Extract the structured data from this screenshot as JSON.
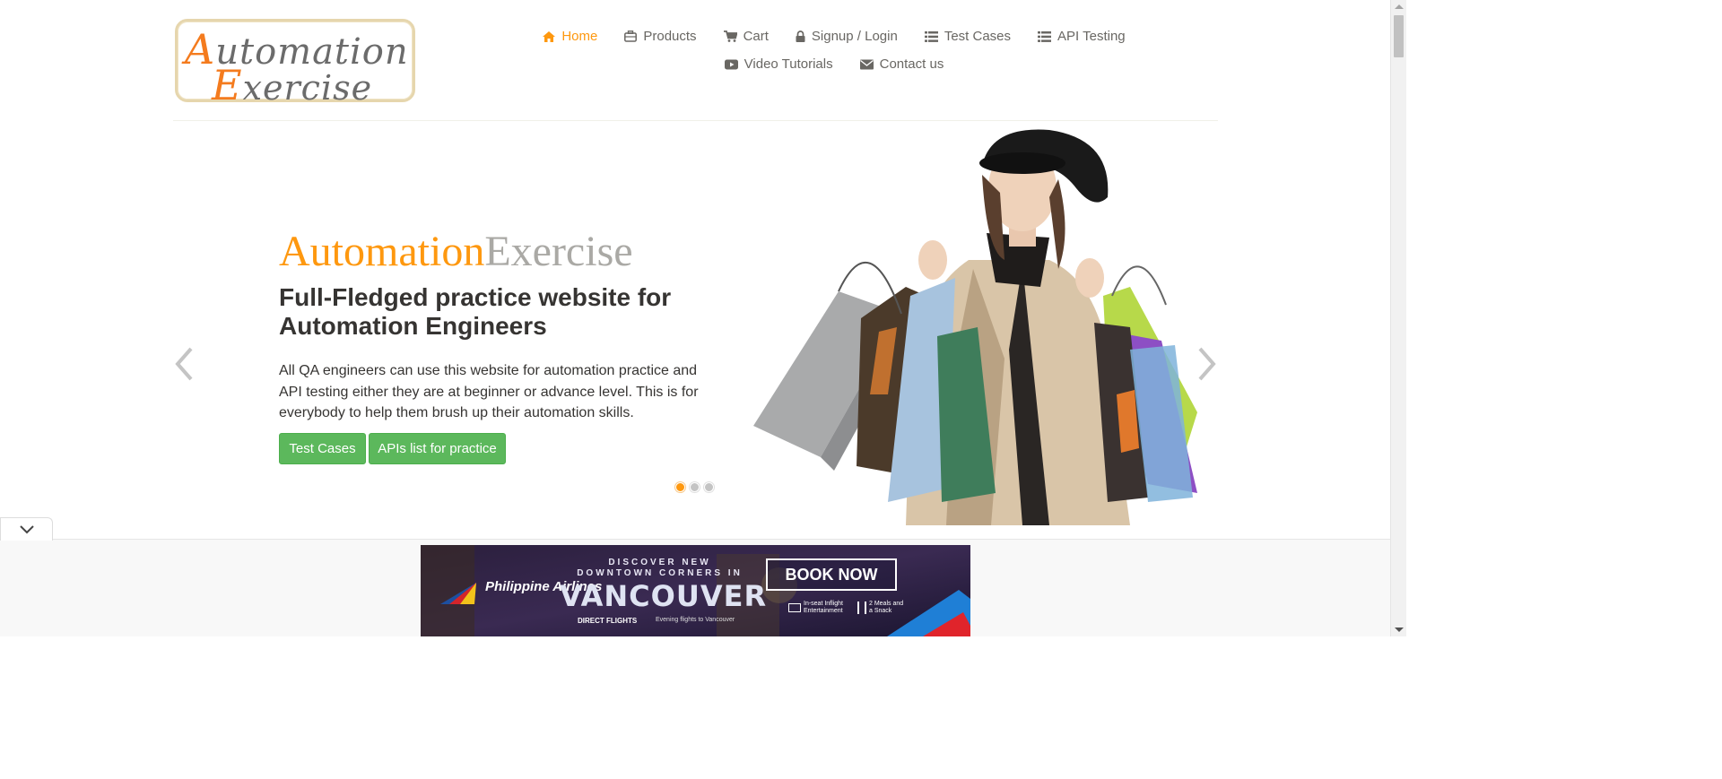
{
  "logo": {
    "line1_cap": "A",
    "line1_rest": "utomation",
    "line2_cap": "E",
    "line2_rest": "xercise"
  },
  "nav": {
    "row1": [
      {
        "label": "Home",
        "icon": "home-icon",
        "active": true
      },
      {
        "label": "Products",
        "icon": "briefcase-icon"
      },
      {
        "label": "Cart",
        "icon": "cart-icon"
      },
      {
        "label": "Signup / Login",
        "icon": "lock-icon"
      },
      {
        "label": "Test Cases",
        "icon": "list-icon"
      },
      {
        "label": "API Testing",
        "icon": "list-icon"
      }
    ],
    "row2": [
      {
        "label": "Video Tutorials",
        "icon": "youtube-play-icon"
      },
      {
        "label": "Contact us",
        "icon": "envelope-icon"
      }
    ]
  },
  "slider": {
    "brand_a": "Automation",
    "brand_b": "Exercise",
    "headline": "Full-Fledged practice website for Automation Engineers",
    "description": "All QA engineers can use this website for automation practice and API testing either they are at beginner or advance level. This is for everybody to help them brush up their automation skills.",
    "btn_test_cases": "Test Cases",
    "btn_apis": "APIs list for practice",
    "slide_count": 3,
    "active_slide": 1
  },
  "ad": {
    "airline": "Philippine Airlines",
    "line1": "DISCOVER NEW",
    "line2": "DOWNTOWN CORNERS IN",
    "city": "VANCOUVER",
    "direct": "DIRECT FLIGHTS",
    "sub": "Evening flights to Vancouver",
    "cta": "BOOK NOW",
    "feature1": "In-seat Inflight Entertainment",
    "feature2": "2 Meals and a Snack"
  },
  "colors": {
    "accent": "#fe980f",
    "button_green": "#5cb85c",
    "muted": "#aaa9a5",
    "nav_text": "#696763"
  }
}
